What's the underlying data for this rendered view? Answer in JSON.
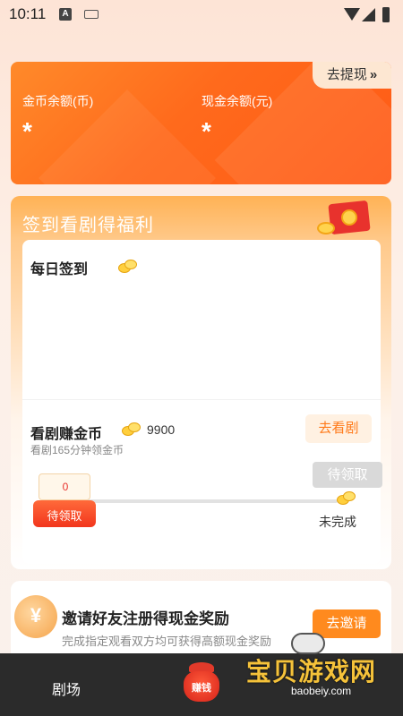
{
  "status_bar": {
    "time": "10:11",
    "a_badge": "A"
  },
  "balance": {
    "withdraw_label": "去提现",
    "withdraw_arrow": "»",
    "coin_label": "金币余额(币)",
    "coin_value": "*",
    "cash_label": "现金余额(元)",
    "cash_value": "*"
  },
  "signin": {
    "title": "签到看剧得福利",
    "daily_title": "每日签到",
    "watch_title": "看剧赚金币",
    "watch_coins": "9900",
    "watch_sub": "看剧165分钟领金币",
    "watch_button": "去看剧",
    "chest_value": "0",
    "chest_label": "待领取",
    "pending_button": "待领取",
    "unfinished_label": "未完成"
  },
  "invite": {
    "icon_text": "¥",
    "title": "邀请好友注册得现金奖励",
    "subtitle": "完成指定观看双方均可获得高额现金奖励",
    "button": "去邀请"
  },
  "bottom_nav": {
    "theater": "剧场",
    "earn": "赚钱"
  },
  "watermark": {
    "title": "宝贝游戏网",
    "url": "baobeiy.com"
  },
  "colors": {
    "accent": "#ff6a1c",
    "button_orange": "#ff8a1e",
    "nav_bg": "#2b2b2b"
  }
}
